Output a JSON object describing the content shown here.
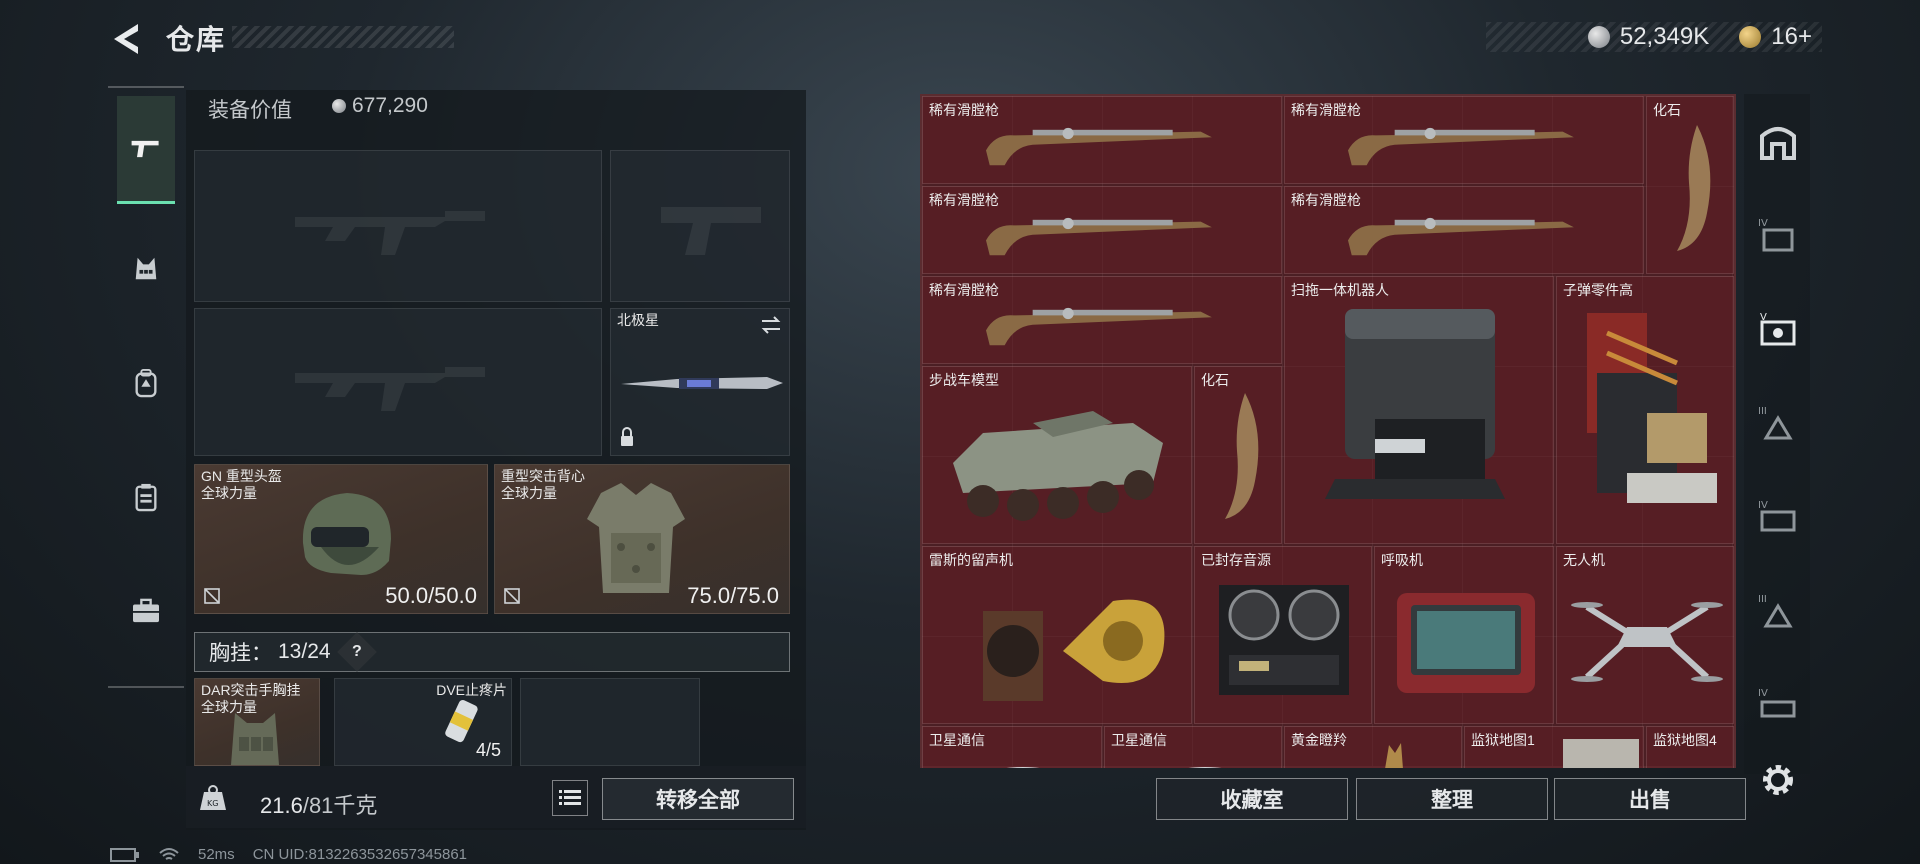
{
  "header": {
    "title": "仓库",
    "back_icon": "back-arrow-icon",
    "currency": [
      {
        "icon": "silver-coin-icon",
        "value": "52,349K"
      },
      {
        "icon": "gold-coin-icon",
        "value": "16+"
      }
    ]
  },
  "left_nav": {
    "items": [
      {
        "name": "weapons",
        "icon": "pistol-icon",
        "active": true
      },
      {
        "name": "vest",
        "icon": "vest-icon",
        "active": false
      },
      {
        "name": "backpack",
        "icon": "backpack-icon",
        "active": false
      },
      {
        "name": "container",
        "icon": "container-icon",
        "active": false
      },
      {
        "name": "case",
        "icon": "briefcase-icon",
        "active": false
      }
    ]
  },
  "equipment": {
    "value_label": "装备价值",
    "value": "677,290",
    "secondary_slot": {
      "label": "北极星",
      "swap_icon": "swap-icon",
      "lock_icon": "lock-icon"
    },
    "helmet": {
      "label": "GN 重型头盔\n全球力量",
      "durability": "50.0/50.0"
    },
    "armor": {
      "label": "重型突击背心\n全球力量",
      "durability": "75.0/75.0"
    },
    "vest_bar": {
      "label": "胸挂：",
      "count": "13/24",
      "help": "?"
    },
    "vest_items": [
      {
        "label": "DAR突击手胸挂\n全球力量"
      },
      {
        "label": "DVE止疼片",
        "count": "4/5"
      }
    ],
    "weight": {
      "current": "21.6",
      "max": "/81千克"
    },
    "transfer_all": "转移全部"
  },
  "stash": {
    "items": [
      {
        "label": "稀有滑膛枪"
      },
      {
        "label": "稀有滑膛枪"
      },
      {
        "label": "化石"
      },
      {
        "label": "稀有滑膛枪"
      },
      {
        "label": "稀有滑膛枪"
      },
      {
        "label": "稀有滑膛枪"
      },
      {
        "label": "扫拖一体机器人"
      },
      {
        "label": "子弹零件高"
      },
      {
        "label": "步战车模型"
      },
      {
        "label": "化石"
      },
      {
        "label": "雷斯的留声机"
      },
      {
        "label": "已封存音源"
      },
      {
        "label": "呼吸机"
      },
      {
        "label": "无人机"
      },
      {
        "label": "卫星通信"
      },
      {
        "label": "卫星通信"
      },
      {
        "label": "黄金瞪羚"
      },
      {
        "label": "监狱地图1"
      },
      {
        "label": "监狱地图4"
      }
    ],
    "actions": {
      "collection": "收藏室",
      "sort": "整理",
      "sell": "出售"
    }
  },
  "right_nav": {
    "items": [
      "stash-home-icon",
      "tier-iv-case-icon",
      "tier-v-case-icon",
      "tier-iii-case-icon",
      "tier-iv-map-icon",
      "tier-iii-map-icon",
      "tier-iv-box-icon"
    ],
    "settings_icon": "settings-gear-icon"
  },
  "status_bar": {
    "ping": "52ms",
    "uid": "CN UID:8132263532657345861"
  }
}
